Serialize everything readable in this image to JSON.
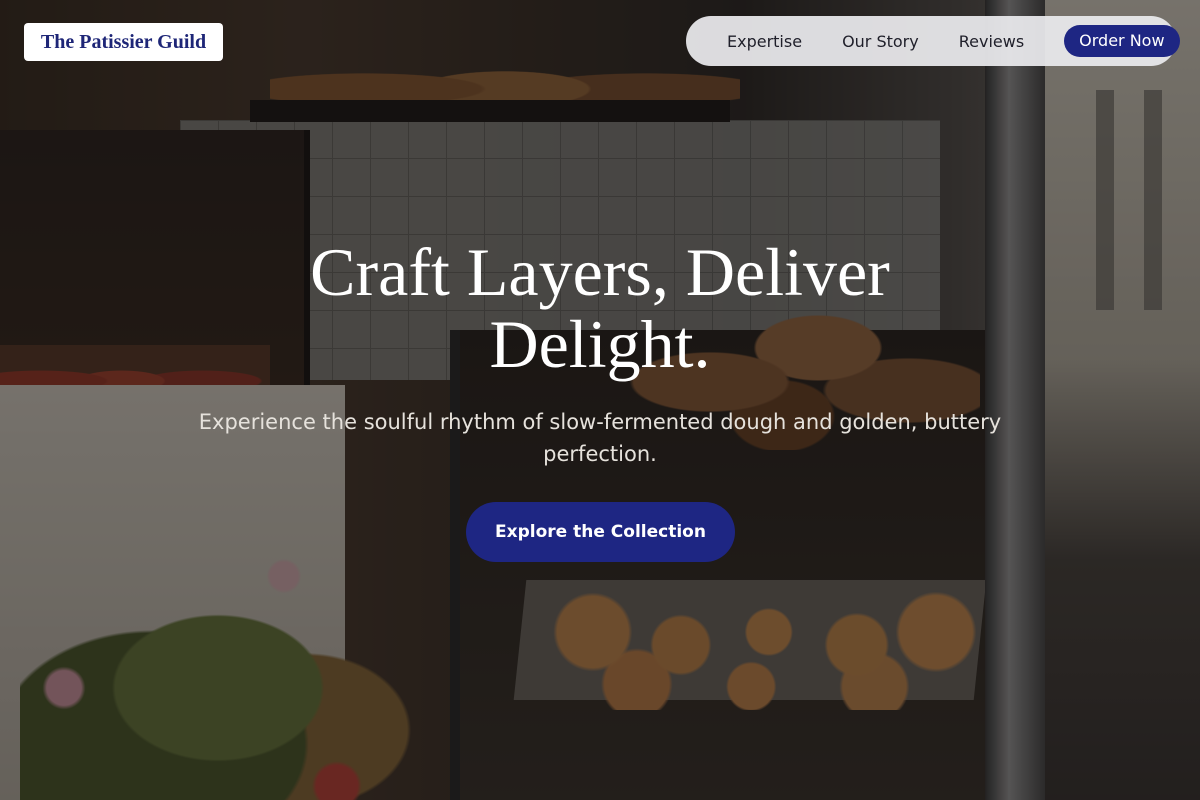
{
  "header": {
    "brand": "The Patissier Guild",
    "nav": {
      "items": [
        "Expertise",
        "Our Story",
        "Reviews"
      ],
      "order_label": "Order Now"
    }
  },
  "hero": {
    "title_line1": "Craft Layers, Deliver",
    "title_line2": "Delight.",
    "subtitle": "Experience the soulful rhythm of slow-fermented dough and golden, buttery perfection.",
    "cta_label": "Explore the Collection"
  },
  "colors": {
    "brand_navy": "#1e2683",
    "nav_background": "#ebebee",
    "brand_chip_background": "#ffffff"
  }
}
